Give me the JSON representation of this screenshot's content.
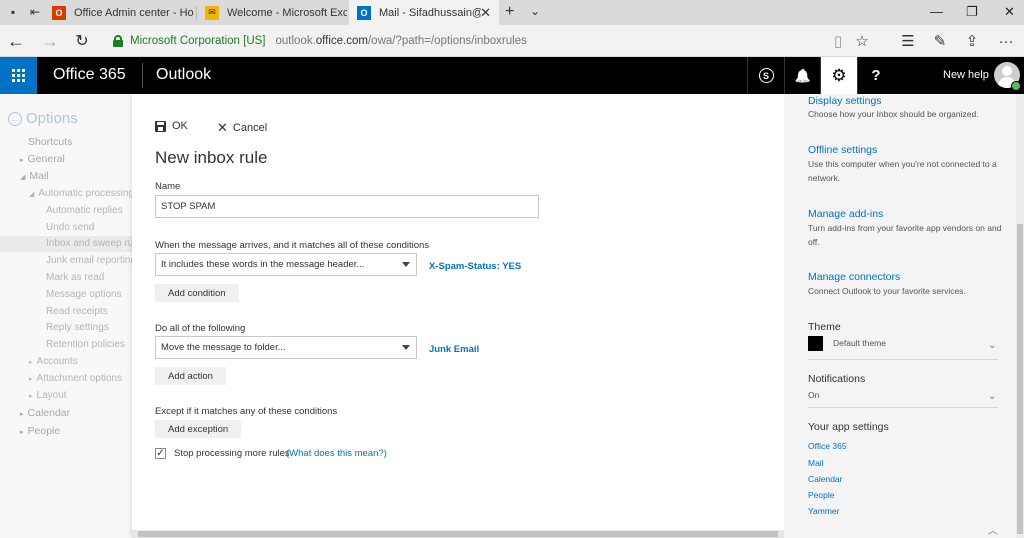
{
  "browser": {
    "tabs": [
      {
        "title": "Office Admin center - Home",
        "icon": "office-logo-icon",
        "color": "#d83b01"
      },
      {
        "title": "Welcome - Microsoft Exchange",
        "icon": "exchange-icon",
        "color": "#f2b600"
      },
      {
        "title": "Mail - Sifadhussain@NewHelp",
        "icon": "outlook-icon",
        "color": "#0072c6"
      }
    ],
    "window_controls": {
      "minimize": "—",
      "restore": "❐",
      "close": "✕"
    },
    "address": {
      "org": "Microsoft Corporation [US]",
      "url_prefix": "outlook.",
      "url_domain": "office.com",
      "url_path": "/owa/?path=/options/inboxrules"
    }
  },
  "suite": {
    "brand": "Office 365",
    "app": "Outlook",
    "user": "New help",
    "skype_glyph": "S",
    "help_glyph": "?",
    "bell_glyph": "🔔",
    "gear_glyph": "⚙"
  },
  "leftnav": {
    "title": "Options",
    "items": [
      {
        "label": "Shortcuts",
        "level": 0,
        "caret": ""
      },
      {
        "label": "General",
        "level": 0,
        "caret": "▸"
      },
      {
        "label": "Mail",
        "level": 0,
        "caret": "◢"
      },
      {
        "label": "Automatic processing",
        "level": 1,
        "caret": "◢"
      },
      {
        "label": "Automatic replies",
        "level": 2,
        "caret": ""
      },
      {
        "label": "Undo send",
        "level": 2,
        "caret": ""
      },
      {
        "label": "Inbox and sweep rules",
        "level": 2,
        "caret": "",
        "selected": true
      },
      {
        "label": "Junk email reporting",
        "level": 2,
        "caret": ""
      },
      {
        "label": "Mark as read",
        "level": 2,
        "caret": ""
      },
      {
        "label": "Message options",
        "level": 2,
        "caret": ""
      },
      {
        "label": "Read receipts",
        "level": 2,
        "caret": ""
      },
      {
        "label": "Reply settings",
        "level": 2,
        "caret": ""
      },
      {
        "label": "Retention policies",
        "level": 2,
        "caret": ""
      },
      {
        "label": "Accounts",
        "level": 1,
        "caret": "▸"
      },
      {
        "label": "Attachment options",
        "level": 1,
        "caret": "▸"
      },
      {
        "label": "Layout",
        "level": 1,
        "caret": "▸"
      },
      {
        "label": "Calendar",
        "level": 0,
        "caret": "▸"
      },
      {
        "label": "People",
        "level": 0,
        "caret": "▸"
      }
    ]
  },
  "dialog": {
    "ok_label": "OK",
    "cancel_label": "Cancel",
    "title": "New inbox rule",
    "name_label": "Name",
    "name_value": "STOP SPAM",
    "conditions_label": "When the message arrives, and it matches all of these conditions",
    "condition_select": "It includes these words in the message header...",
    "condition_value": "X-Spam-Status: YES",
    "add_condition": "Add condition",
    "actions_label": "Do all of the following",
    "action_select": "Move the message to folder...",
    "action_value": "Junk Email",
    "add_action": "Add action",
    "exceptions_label": "Except if it matches any of these conditions",
    "add_exception": "Add exception",
    "stop_processing_label": "Stop processing more rules",
    "stop_processing_checked": true,
    "stop_processing_link": "(What does this mean?)"
  },
  "rightpane": {
    "display": {
      "title": "Display settings",
      "desc": "Choose how your Inbox should be organized."
    },
    "offline": {
      "title": "Offline settings",
      "desc": "Use this computer when you're not connected to a network."
    },
    "addins": {
      "title": "Manage add-ins",
      "desc": "Turn add-ins from your favorite app vendors on and off."
    },
    "connectors": {
      "title": "Manage connectors",
      "desc": "Connect Outlook to your favorite services."
    },
    "theme": {
      "title": "Theme",
      "value": "Default theme"
    },
    "notifications": {
      "title": "Notifications",
      "value": "On"
    },
    "app_settings": {
      "title": "Your app settings",
      "apps": [
        "Office 365",
        "Mail",
        "Calendar",
        "People",
        "Yammer"
      ]
    }
  }
}
